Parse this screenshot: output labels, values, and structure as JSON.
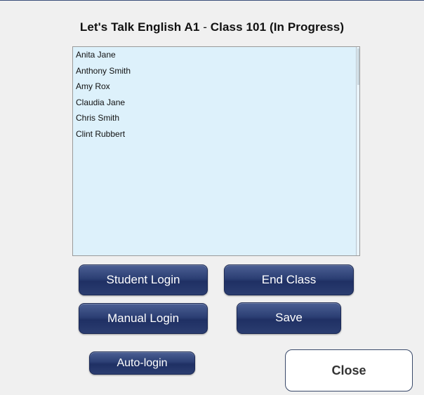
{
  "dialog": {
    "title_part1": "Let's Talk English A1",
    "title_sep": " - ",
    "title_part2": "Class 101 (In Progress)"
  },
  "students": [
    "Anita Jane",
    "Anthony Smith",
    "Amy Rox",
    "Claudia Jane",
    "Chris Smith",
    "Clint Rubbert"
  ],
  "buttons": {
    "student_login": "Student Login",
    "end_class": "End Class",
    "manual_login": "Manual Login",
    "save": "Save",
    "auto_login": "Auto-login",
    "close": "Close"
  },
  "colors": {
    "list_background": "#ddf1fb",
    "button_navy": "#2c3f74",
    "page_background": "#f0f0f0"
  }
}
